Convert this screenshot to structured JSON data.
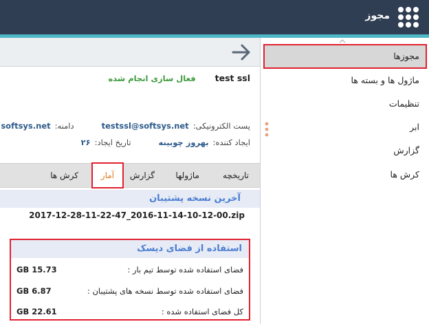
{
  "header": {
    "app_title": "مجوز",
    "apps_icon": "grid-apps-icon",
    "bar_color": "#2f3e53",
    "accent_color": "#4fb8c7"
  },
  "sidebar": {
    "items": [
      {
        "label": "مجوزها",
        "active": true
      },
      {
        "label": "ماژول ها و بسته ها"
      },
      {
        "label": "تنظیمات"
      },
      {
        "label": "ابر"
      },
      {
        "label": "گزارش"
      },
      {
        "label": "کرش ها"
      }
    ]
  },
  "toolbar": {
    "back_icon": "arrow-right-icon"
  },
  "license": {
    "name": "test ssl",
    "status": "فعال سازی انجام شده",
    "status_color": "#3c9a3c",
    "email_label": "پست الکترونیکی:",
    "email_value": "testssl@softsys.net",
    "domain_label": "دامنه:",
    "domain_value": "softsys.net",
    "creator_label": "ایجاد کننده:",
    "creator_value": "بهروز چوبینه",
    "created_label": "تاریخ ایجاد:",
    "created_value": "۲۶"
  },
  "tabs": [
    {
      "label": "تاریخچه"
    },
    {
      "label": "ماژولها"
    },
    {
      "label": "گزارش"
    },
    {
      "label": "آمار",
      "active": true
    },
    {
      "label": "کرش ها"
    }
  ],
  "backup": {
    "title": "آخرین نسخه پشتیبان",
    "file": "2017-12-28-11-22-47_2016-11-14-10-12-00.zip"
  },
  "disk": {
    "title": "استفاده از فضای دیسک",
    "rows": [
      {
        "label": "فضای استفاده شده توسط تیم بار :",
        "value": "GB 15.73"
      },
      {
        "label": "فضای استفاده شده توسط نسخه های پشتیبان :",
        "value": "GB 6.87"
      },
      {
        "label": "کل فضای استفاده شده :",
        "value": "GB 22.61"
      }
    ]
  }
}
